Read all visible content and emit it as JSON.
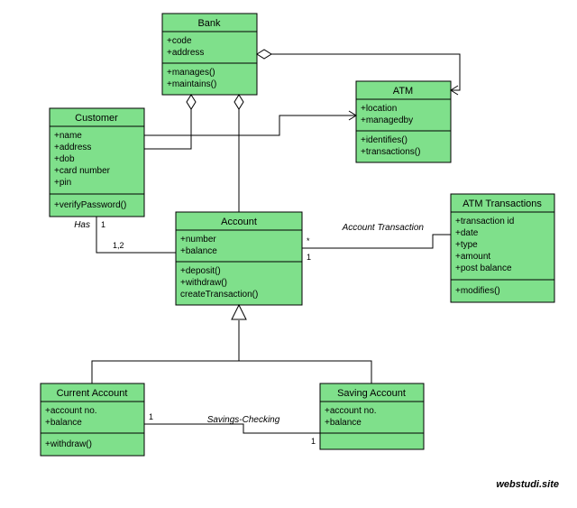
{
  "classes": {
    "bank": {
      "name": "Bank",
      "attrs": [
        "+code",
        "+address"
      ],
      "ops": [
        "+manages()",
        "+maintains()"
      ]
    },
    "customer": {
      "name": "Customer",
      "attrs": [
        "+name",
        "+address",
        "+dob",
        "+card number",
        "+pin"
      ],
      "ops": [
        "+verifyPassword()"
      ]
    },
    "atm": {
      "name": "ATM",
      "attrs": [
        "+location",
        "+managedby"
      ],
      "ops": [
        "+identifies()",
        "+transactions()"
      ]
    },
    "account": {
      "name": "Account",
      "attrs": [
        "+number",
        "+balance"
      ],
      "ops": [
        "+deposit()",
        "+withdraw()",
        "createTransaction()"
      ]
    },
    "atmTrans": {
      "name": "ATM Transactions",
      "attrs": [
        "+transaction id",
        "+date",
        "+type",
        "+amount",
        "+post balance"
      ],
      "ops": [
        "+modifies()"
      ]
    },
    "current": {
      "name": "Current Account",
      "attrs": [
        "+account no.",
        "+balance"
      ],
      "ops": [
        "+withdraw()"
      ]
    },
    "saving": {
      "name": "Saving Account",
      "attrs": [
        "+account no.",
        "+balance"
      ],
      "ops": []
    }
  },
  "labels": {
    "has": "Has",
    "accountTransaction": "Account Transaction",
    "savingsChecking": "Savings-Checking"
  },
  "mult": {
    "has1": "1",
    "has12": "1,2",
    "accStar": "*",
    "acc1": "1",
    "sc1a": "1",
    "sc1b": "1"
  },
  "watermark": "webstudi.site"
}
